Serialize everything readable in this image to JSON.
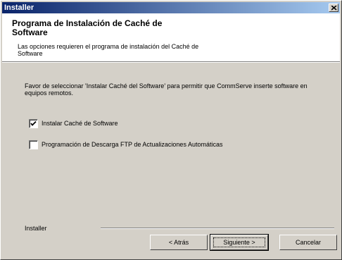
{
  "window": {
    "title": "Installer"
  },
  "header": {
    "title": "Programa de Instalación de Caché de Software",
    "subtitle": "Las opciones requieren el programa de instalación del Caché de Software"
  },
  "body": {
    "description": "Favor de seleccionar 'Instalar Caché del Software' para permitir que CommServe inserte software en equipos remotos.",
    "options": [
      {
        "label": "Instalar Caché de Software",
        "checked": true
      },
      {
        "label": "Programación de Descarga FTP de Actualizaciones Automáticas",
        "checked": false
      }
    ]
  },
  "footer": {
    "brand_label": "Installer",
    "back_label": "< Atrás",
    "next_label": "Siguiente >",
    "cancel_label": "Cancelar"
  },
  "colors": {
    "titlebar_start": "#0a246a",
    "titlebar_end": "#a6caf0",
    "face": "#d4d0c8"
  }
}
